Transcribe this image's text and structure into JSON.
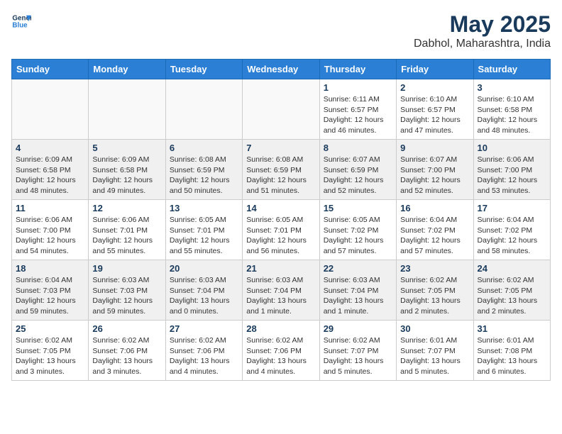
{
  "header": {
    "logo_line1": "General",
    "logo_line2": "Blue",
    "month": "May 2025",
    "location": "Dabhol, Maharashtra, India"
  },
  "weekdays": [
    "Sunday",
    "Monday",
    "Tuesday",
    "Wednesday",
    "Thursday",
    "Friday",
    "Saturday"
  ],
  "weeks": [
    [
      {
        "day": "",
        "info": "",
        "empty": true
      },
      {
        "day": "",
        "info": "",
        "empty": true
      },
      {
        "day": "",
        "info": "",
        "empty": true
      },
      {
        "day": "",
        "info": "",
        "empty": true
      },
      {
        "day": "1",
        "info": "Sunrise: 6:11 AM\nSunset: 6:57 PM\nDaylight: 12 hours and 46 minutes."
      },
      {
        "day": "2",
        "info": "Sunrise: 6:10 AM\nSunset: 6:57 PM\nDaylight: 12 hours and 47 minutes."
      },
      {
        "day": "3",
        "info": "Sunrise: 6:10 AM\nSunset: 6:58 PM\nDaylight: 12 hours and 48 minutes."
      }
    ],
    [
      {
        "day": "4",
        "info": "Sunrise: 6:09 AM\nSunset: 6:58 PM\nDaylight: 12 hours and 48 minutes."
      },
      {
        "day": "5",
        "info": "Sunrise: 6:09 AM\nSunset: 6:58 PM\nDaylight: 12 hours and 49 minutes."
      },
      {
        "day": "6",
        "info": "Sunrise: 6:08 AM\nSunset: 6:59 PM\nDaylight: 12 hours and 50 minutes."
      },
      {
        "day": "7",
        "info": "Sunrise: 6:08 AM\nSunset: 6:59 PM\nDaylight: 12 hours and 51 minutes."
      },
      {
        "day": "8",
        "info": "Sunrise: 6:07 AM\nSunset: 6:59 PM\nDaylight: 12 hours and 52 minutes."
      },
      {
        "day": "9",
        "info": "Sunrise: 6:07 AM\nSunset: 7:00 PM\nDaylight: 12 hours and 52 minutes."
      },
      {
        "day": "10",
        "info": "Sunrise: 6:06 AM\nSunset: 7:00 PM\nDaylight: 12 hours and 53 minutes."
      }
    ],
    [
      {
        "day": "11",
        "info": "Sunrise: 6:06 AM\nSunset: 7:00 PM\nDaylight: 12 hours and 54 minutes."
      },
      {
        "day": "12",
        "info": "Sunrise: 6:06 AM\nSunset: 7:01 PM\nDaylight: 12 hours and 55 minutes."
      },
      {
        "day": "13",
        "info": "Sunrise: 6:05 AM\nSunset: 7:01 PM\nDaylight: 12 hours and 55 minutes."
      },
      {
        "day": "14",
        "info": "Sunrise: 6:05 AM\nSunset: 7:01 PM\nDaylight: 12 hours and 56 minutes."
      },
      {
        "day": "15",
        "info": "Sunrise: 6:05 AM\nSunset: 7:02 PM\nDaylight: 12 hours and 57 minutes."
      },
      {
        "day": "16",
        "info": "Sunrise: 6:04 AM\nSunset: 7:02 PM\nDaylight: 12 hours and 57 minutes."
      },
      {
        "day": "17",
        "info": "Sunrise: 6:04 AM\nSunset: 7:02 PM\nDaylight: 12 hours and 58 minutes."
      }
    ],
    [
      {
        "day": "18",
        "info": "Sunrise: 6:04 AM\nSunset: 7:03 PM\nDaylight: 12 hours and 59 minutes."
      },
      {
        "day": "19",
        "info": "Sunrise: 6:03 AM\nSunset: 7:03 PM\nDaylight: 12 hours and 59 minutes."
      },
      {
        "day": "20",
        "info": "Sunrise: 6:03 AM\nSunset: 7:04 PM\nDaylight: 13 hours and 0 minutes."
      },
      {
        "day": "21",
        "info": "Sunrise: 6:03 AM\nSunset: 7:04 PM\nDaylight: 13 hours and 1 minute."
      },
      {
        "day": "22",
        "info": "Sunrise: 6:03 AM\nSunset: 7:04 PM\nDaylight: 13 hours and 1 minute."
      },
      {
        "day": "23",
        "info": "Sunrise: 6:02 AM\nSunset: 7:05 PM\nDaylight: 13 hours and 2 minutes."
      },
      {
        "day": "24",
        "info": "Sunrise: 6:02 AM\nSunset: 7:05 PM\nDaylight: 13 hours and 2 minutes."
      }
    ],
    [
      {
        "day": "25",
        "info": "Sunrise: 6:02 AM\nSunset: 7:05 PM\nDaylight: 13 hours and 3 minutes."
      },
      {
        "day": "26",
        "info": "Sunrise: 6:02 AM\nSunset: 7:06 PM\nDaylight: 13 hours and 3 minutes."
      },
      {
        "day": "27",
        "info": "Sunrise: 6:02 AM\nSunset: 7:06 PM\nDaylight: 13 hours and 4 minutes."
      },
      {
        "day": "28",
        "info": "Sunrise: 6:02 AM\nSunset: 7:06 PM\nDaylight: 13 hours and 4 minutes."
      },
      {
        "day": "29",
        "info": "Sunrise: 6:02 AM\nSunset: 7:07 PM\nDaylight: 13 hours and 5 minutes."
      },
      {
        "day": "30",
        "info": "Sunrise: 6:01 AM\nSunset: 7:07 PM\nDaylight: 13 hours and 5 minutes."
      },
      {
        "day": "31",
        "info": "Sunrise: 6:01 AM\nSunset: 7:08 PM\nDaylight: 13 hours and 6 minutes."
      }
    ]
  ]
}
